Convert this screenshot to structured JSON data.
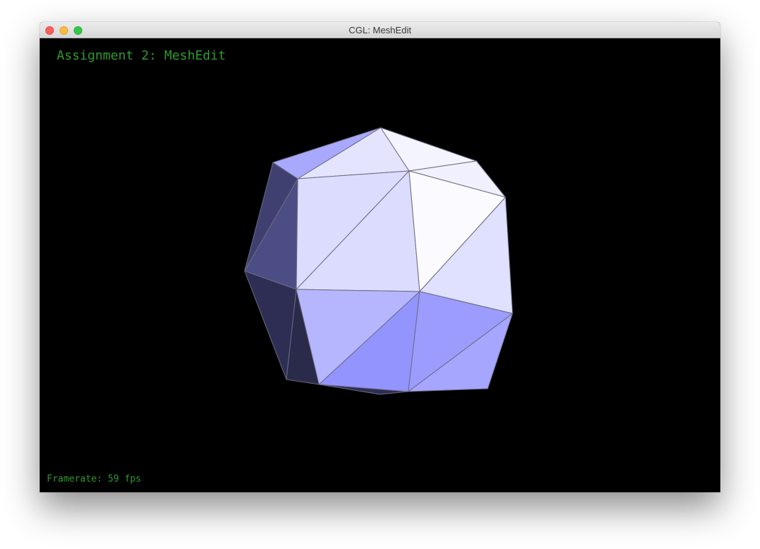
{
  "window": {
    "title": "CGL: MeshEdit"
  },
  "viewport": {
    "hud_title": "Assignment 2: MeshEdit",
    "framerate_text": "Framerate: 59 fps",
    "background": "#000000",
    "text_color": "#2f9a2f"
  },
  "mesh": {
    "edge_color": "#6a6a80",
    "face_colors": [
      "#fbfbff",
      "#f0f0ff",
      "#e0e0ff",
      "#dcdcff",
      "#b6b6ff",
      "#9494ff",
      "#a4a4ff",
      "#5050a0",
      "#404070",
      "#2e2e55"
    ]
  }
}
